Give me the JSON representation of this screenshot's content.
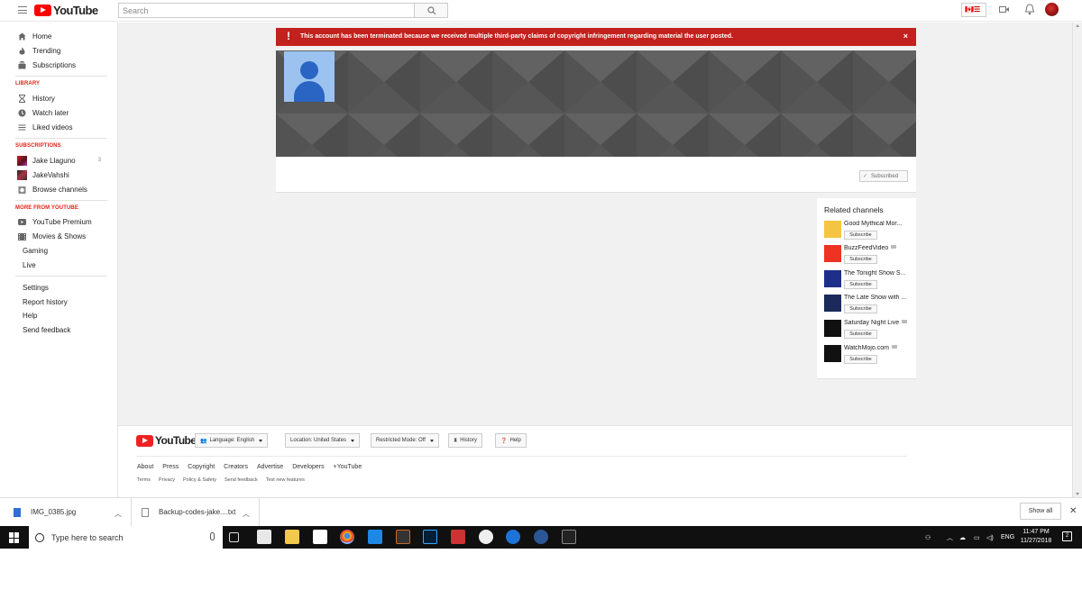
{
  "header": {
    "logo_text": "YouTube",
    "search_placeholder": "Search",
    "flag_label": "🇨🇦☰"
  },
  "sidebar": {
    "top": [
      {
        "label": "Home",
        "icon": "home-icon"
      },
      {
        "label": "Trending",
        "icon": "flame-icon"
      },
      {
        "label": "Subscriptions",
        "icon": "subscriptions-icon"
      }
    ],
    "library_heading": "LIBRARY",
    "library": [
      {
        "label": "History",
        "icon": "hourglass-icon"
      },
      {
        "label": "Watch later",
        "icon": "clock-icon"
      },
      {
        "label": "Liked videos",
        "icon": "list-icon"
      }
    ],
    "subscriptions_heading": "SUBSCRIPTIONS",
    "subscriptions": [
      {
        "label": "Jake Llaguno",
        "count": "3"
      },
      {
        "label": "JakeVahshi",
        "count": ""
      },
      {
        "label": "Browse channels",
        "count": ""
      }
    ],
    "more_heading": "MORE FROM YOUTUBE",
    "more": [
      {
        "label": "YouTube Premium",
        "icon": "youtube-premium-icon"
      },
      {
        "label": "Movies & Shows",
        "icon": "film-icon"
      },
      {
        "label": "Gaming"
      },
      {
        "label": "Live"
      }
    ],
    "settings": [
      {
        "label": "Settings"
      },
      {
        "label": "Report history"
      },
      {
        "label": "Help"
      },
      {
        "label": "Send feedback"
      }
    ]
  },
  "alert": {
    "message": "This account has been terminated because we received multiple third-party claims of copyright infringement regarding material the user posted.",
    "close": "×"
  },
  "channel": {
    "subscribed_label": "Subscribed"
  },
  "related": {
    "title": "Related channels",
    "subscribe_label": "Subscribe",
    "channels": [
      {
        "name": "Good Mythical Mor...",
        "color": "#f5c542",
        "verified": false
      },
      {
        "name": "BuzzFeedVideo",
        "color": "#ee3322",
        "verified": true
      },
      {
        "name": "The Tonight Show S...",
        "color": "#1d2f8a",
        "verified": false
      },
      {
        "name": "The Late Show with ...",
        "color": "#1a2a5a",
        "verified": false
      },
      {
        "name": "Saturday Night Live",
        "color": "#111111",
        "verified": true
      },
      {
        "name": "WatchMojo.com",
        "color": "#111111",
        "verified": true
      }
    ]
  },
  "footer": {
    "logo_text": "YouTube",
    "language": "Language: English",
    "location": "Location: United States",
    "restricted": "Restricted Mode: Off",
    "history": "History",
    "help": "Help",
    "links_primary": [
      "About",
      "Press",
      "Copyright",
      "Creators",
      "Advertise",
      "Developers",
      "+YouTube"
    ],
    "links_secondary": [
      "Terms",
      "Privacy",
      "Policy & Safety",
      "Send feedback",
      "Test new features"
    ]
  },
  "downloads": {
    "items": [
      "IMG_0385.jpg",
      "Backup-codes-jake....txt"
    ],
    "show_all": "Show all"
  },
  "taskbar": {
    "search_placeholder": "Type here to search",
    "language": "ENG",
    "time": "11:47 PM",
    "date": "11/27/2018",
    "notification_count": "2"
  },
  "colors": {
    "youtube_red": "#ff0000",
    "alert_red": "#c3211d",
    "section_heading": "#e62117",
    "banner_gray": "#5d5d5d",
    "avatar_blue": "#9cc3f0"
  }
}
